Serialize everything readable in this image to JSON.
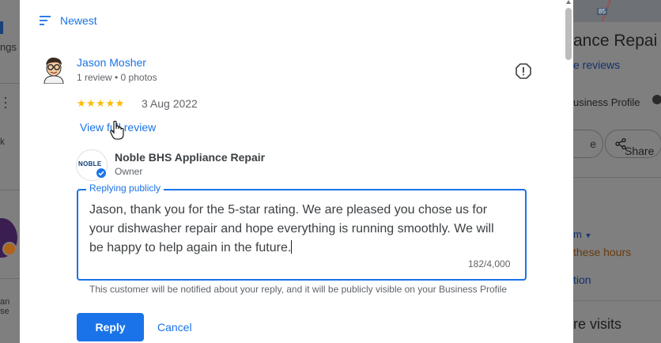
{
  "background": {
    "left_fragment_1": "ngs",
    "left_fragment_2": "k",
    "left_fragment_3": "an se",
    "right_title": "ance Repai",
    "right_reviews_link": "e reviews",
    "right_business_profile": "usiness Profile",
    "right_pill_partial": "e",
    "right_share_label": "Share",
    "right_pm": "m",
    "right_hours": "these hours",
    "right_tion": "tion",
    "right_visits": "re visits",
    "map_badge": "85"
  },
  "dialog": {
    "sort_label": "Newest",
    "review": {
      "reviewer_name": "Jason Mosher",
      "reviewer_meta": "1 review • 0 photos",
      "rating": 5,
      "stars_display": "★★★★★",
      "date": "3 Aug 2022",
      "view_full_label": "View full review"
    },
    "owner": {
      "logo_text": "NOBLE",
      "business_name": "Noble BHS Appliance Repair",
      "role": "Owner"
    },
    "reply": {
      "legend": "Replying publicly",
      "text": "Jason, thank you for the 5-star rating. We are pleased you chose us for your dishwasher repair and hope everything is running smoothly. We will be happy to help again in the future.",
      "counter": "182/4,000",
      "notice": "This customer will be notified about your reply, and it will be publicly visible on your Business Profile"
    },
    "buttons": {
      "reply_label": "Reply",
      "cancel_label": "Cancel"
    }
  },
  "colors": {
    "accent": "#1a73e8",
    "star": "#fbbc04",
    "overlay": "#7f7f7f"
  }
}
